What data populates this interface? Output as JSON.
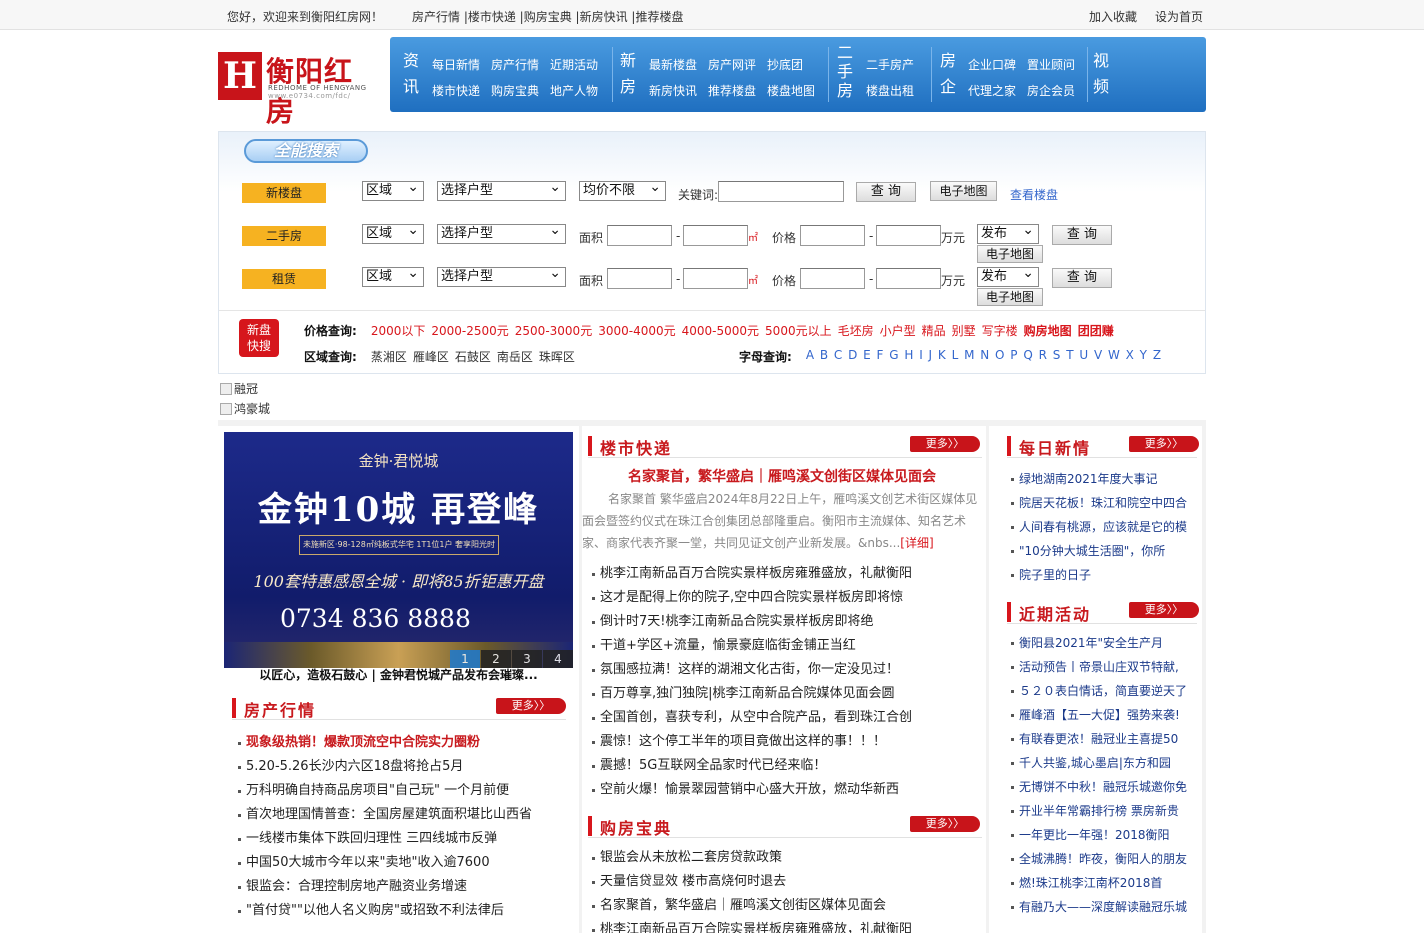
{
  "topbar": {
    "welcome": "您好，欢迎来到衡阳红房网！",
    "links": [
      "房产行情 |",
      "楼市快递 |",
      "购房宝典 |",
      "新房快讯 |",
      "推荐楼盘"
    ],
    "add_fav": "加入收藏",
    "set_home": "设为首页"
  },
  "logo": {
    "mark": "H",
    "name": "衡阳红房",
    "en": "REDHOME OF HENGYANG",
    "url": "www.e0734.com/fdc/"
  },
  "nav": {
    "groups": [
      {
        "cat": [
          "资",
          "讯"
        ],
        "row1": [
          "每日新情",
          "房产行情",
          "近期活动"
        ],
        "row2": [
          "楼市快递",
          "购房宝典",
          "地产人物"
        ]
      },
      {
        "cat": [
          "新",
          "房"
        ],
        "row1": [
          "最新楼盘",
          "房产网评",
          "抄底团"
        ],
        "row2": [
          "新房快讯",
          "推荐楼盘",
          "楼盘地图"
        ]
      },
      {
        "cat": [
          "二",
          "手",
          "房"
        ],
        "row1": [
          "二手房产"
        ],
        "row2": [
          "楼盘出租"
        ]
      },
      {
        "cat": [
          "房",
          "企"
        ],
        "row1": [
          "企业口碑",
          "置业顾问"
        ],
        "row2": [
          "代理之家",
          "房企会员"
        ]
      },
      {
        "cat": [
          "视",
          "频"
        ],
        "row1": [],
        "row2": []
      }
    ]
  },
  "search": {
    "title": "全能搜索",
    "new": {
      "tag": "新楼盘",
      "area": "区域",
      "type": "选择户型",
      "price": "均价不限",
      "kw_label": "关键词:",
      "search": "查 询",
      "map": "电子地图",
      "view": "查看楼盘"
    },
    "second": {
      "tag": "二手房",
      "area": "区域",
      "type": "选择户型",
      "area_label": "面积",
      "unit_area": "㎡",
      "price_label": "价格",
      "unit_price": "万元",
      "publish": "发布",
      "search": "查 询",
      "map": "电子地图",
      "dash": "-"
    },
    "rent": {
      "tag": "租赁",
      "area": "区域",
      "type": "选择户型",
      "area_label": "面积",
      "unit_area": "㎡",
      "price_label": "价格",
      "unit_price": "万元",
      "publish": "发布",
      "search": "查 询",
      "map": "电子地图",
      "dash": "-"
    },
    "quick": {
      "icon": [
        "新盘",
        "快搜"
      ],
      "price_label": "价格查询:",
      "prices": [
        "2000以下",
        "2000-2500元",
        "2500-3000元",
        "3000-4000元",
        "4000-5000元",
        "5000元以上",
        "毛坯房",
        "小户型",
        "精品",
        "别墅",
        "写字楼"
      ],
      "price_extra": [
        "购房地图",
        "团团赚"
      ],
      "region_label": "区域查询:",
      "regions": [
        "蒸湘区",
        "雁峰区",
        "石鼓区",
        "南岳区",
        "珠晖区"
      ],
      "letter_label": "字母查询:",
      "letters": "A B C D E F G H I J K L M N O P Q R S T U V W X Y Z"
    }
  },
  "ads": [
    "融冠",
    "鸿豪城"
  ],
  "banner": {
    "brand": "金钟·君悦城",
    "headline": "金钟10城 再登峰",
    "sub": "未施新区·98-128㎡纯板式华宅 1T1位1户 奢享阳光时",
    "offer": "100套特惠感恩全城 · 即将85折钜惠开盘",
    "phone": "0734 836 8888",
    "dots": [
      "1",
      "2",
      "3",
      "4"
    ],
    "caption": "以匠心，造极石鼓心 | 金钟君悦城产品发布会璀璨..."
  },
  "market": {
    "title": "房产行情",
    "more": "更多〉〉",
    "items": [
      "现象级热销！爆款顶流空中合院实力圈粉",
      "5.20-5.26长沙内六区18盘将抢占5月",
      "万科明确自持商品房项目\"自己玩\" 一个月前便",
      "首次地理国情普查：全国房屋建筑面积堪比山西省",
      "一线楼市集体下跌回归理性 三四线城市反弹",
      "中国50大城市今年以来\"卖地\"收入逾7600",
      "银监会：合理控制房地产融资业务增速",
      "\"首付贷\"\"以他人名义购房\"或招致不利法律后"
    ]
  },
  "express": {
    "title": "楼市快递",
    "more": "更多〉〉",
    "headline": "名家聚首，繁华盛启｜雁鸣溪文创街区媒体见面会",
    "summary": "名家聚首 繁华盛启2024年8月22日上午，雁鸣溪文创艺术街区媒体见面会暨签约仪式在珠江合创集团总部隆重启。衡阳市主流媒体、知名艺术家、商家代表齐聚一堂，共同见证文创产业新发展。&nbs...",
    "detail": "[详细]",
    "items": [
      "桃李江南新品百万合院实景样板房雍雅盛放，礼献衡阳",
      "这才是配得上你的院子,空中四合院实景样板房即将惊",
      "倒计时7天!桃李江南新品合院实景样板房即将绝",
      "干道+学区+流量，愉景豪庭临街金铺正当红",
      "氛围感拉满！这样的湖湘文化古街，你一定没见过！",
      "百万尊享,独门独院|桃李江南新品合院媒体见面会圆",
      "全国首创，喜获专利，从空中合院产品，看到珠江合创",
      "震惊！这个停工半年的项目竟做出这样的事！！！",
      "震撼！5G互联网全品家时代已经来临！",
      "空前火爆！愉景翠园营销中心盛大开放，燃动华新西"
    ]
  },
  "guide": {
    "title": "购房宝典",
    "more": "更多〉〉",
    "items": [
      "银监会从未放松二套房贷款政策",
      "天量信贷显效 楼市高烧何时退去",
      "名家聚首，繁华盛启｜雁鸣溪文创街区媒体见面会",
      "桃李江南新品百万合院实景样板房雍雅盛放，礼献衡阳"
    ]
  },
  "daily": {
    "title": "每日新情",
    "more": "更多〉〉",
    "items": [
      "绿地湖南2021年度大事记",
      "院居天花板！珠江和院空中四合",
      "人间春有桃源，应该就是它的模",
      "\"10分钟大城生活圈\"，你所",
      "院子里的日子"
    ]
  },
  "events": {
    "title": "近期活动",
    "more": "更多〉〉",
    "items": [
      "衡阳县2021年\"安全生产月",
      "活动预告丨帝景山庄双节特献,",
      "５２０表白情话，简直要逆天了",
      "雁峰酒【五一大促】强势来袭!",
      "有联春更浓！融冠业主喜提50",
      "千人共鉴,城心墨启|东方和园",
      "无博饼不中秋！融冠乐城邀你免",
      "开业半年常霸排行榜 票房新贵",
      "一年更比一年强！2018衡阳",
      "全城沸腾！昨夜，衡阳人的朋友",
      "燃!珠江桃李江南杯2018首",
      "有融乃大——深度解读融冠乐城"
    ]
  }
}
